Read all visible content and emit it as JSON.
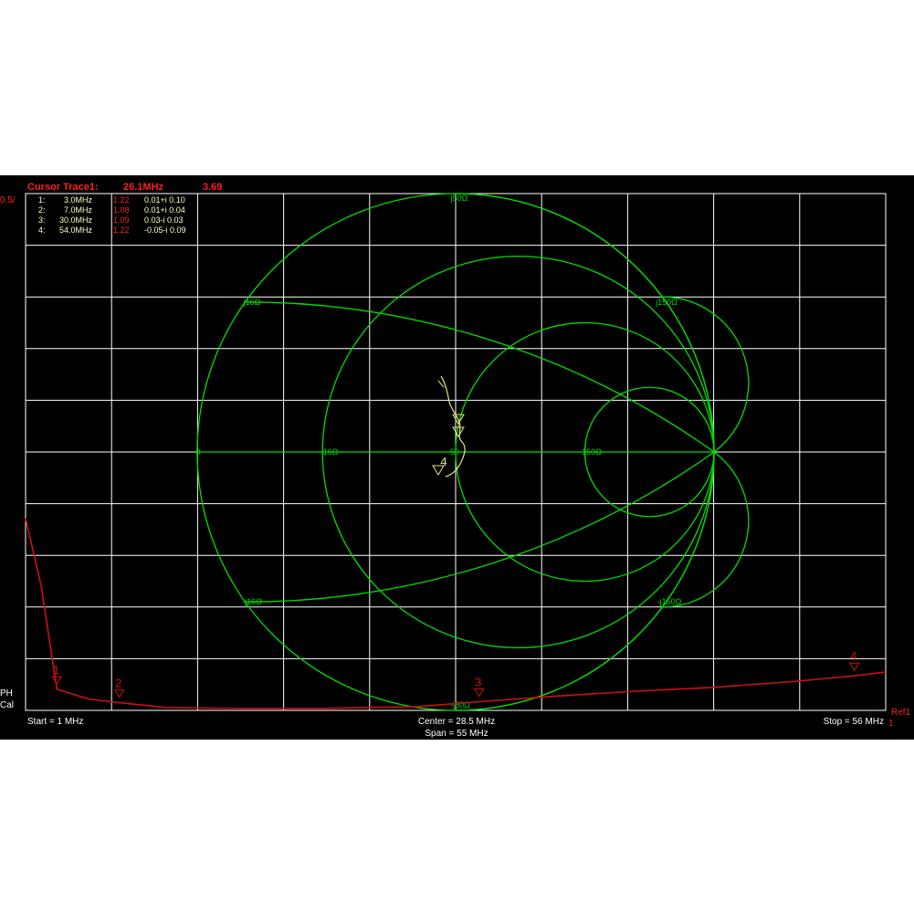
{
  "header": {
    "cursor_label": "Cursor Trace1:",
    "cursor_freq": "26.1MHz",
    "cursor_value": "3.69"
  },
  "scale_label": "0.5/",
  "markers_table": [
    {
      "index": "1:",
      "freq": "3.0MHz",
      "swr": "1.22",
      "z": "0.01+i 0.10"
    },
    {
      "index": "2:",
      "freq": "7.0MHz",
      "swr": "1.08",
      "z": "0.01+i 0.04"
    },
    {
      "index": "3:",
      "freq": "30.0MHz",
      "swr": "1.09",
      "z": "0.03-i 0.03"
    },
    {
      "index": "4:",
      "freq": "54.0MHz",
      "swr": "1.22",
      "z": "-0.05-i 0.09"
    }
  ],
  "smith_labels": {
    "top": "j50Ω",
    "bottom": "-j50Ω",
    "ul": "j16Ω",
    "ur": "j150Ω",
    "ll": "-j16Ω",
    "lr": "-j150Ω",
    "r0": "0",
    "r16": "16Ω",
    "r50": "50",
    "r150": "150Ω"
  },
  "side_labels": {
    "ph": "PH",
    "cal": "Cal"
  },
  "footer": {
    "start": "Start = 1 MHz",
    "center": "Center = 28.5 MHz",
    "span": "Span = 55 MHz",
    "stop": "Stop = 56 MHz",
    "ref": "Ref1",
    "ref_num": "1"
  },
  "trace_markers": [
    "1",
    "2",
    "3",
    "4"
  ],
  "colors": {
    "grid": "#ffffff",
    "smith": "#00dd00",
    "trace_swr": "#cc1111",
    "trace_smith": "#e6e680",
    "header_red": "#ff2020",
    "table_text": "#ffffc0"
  },
  "chart_data": {
    "type": "line",
    "x_range_mhz": [
      1,
      56
    ],
    "series": [
      {
        "x": [
          1,
          2,
          3,
          5,
          7,
          10,
          15,
          20,
          26.1,
          30,
          35,
          40,
          45,
          50,
          54,
          56
        ],
        "values": [
          3.0,
          2.3,
          1.22,
          1.12,
          1.08,
          1.03,
          1.02,
          1.02,
          1.04,
          1.09,
          1.15,
          1.2,
          1.24,
          1.3,
          1.36,
          1.4
        ]
      }
    ]
  }
}
